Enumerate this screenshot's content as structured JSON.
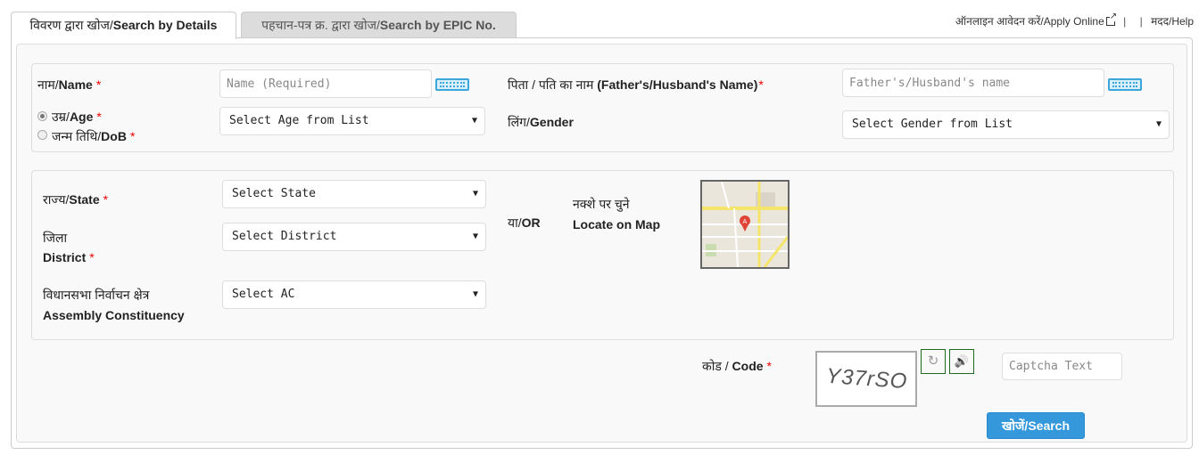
{
  "tabs": [
    {
      "hi": "विवरण द्वारा खोज/",
      "en": "Search by Details",
      "active": true
    },
    {
      "hi": "पहचान-पत्र क्र. द्वारा खोज/",
      "en": "Search by EPIC No.",
      "active": false
    }
  ],
  "top_links": {
    "apply_online": "ऑनलाइन आवेदन करें/Apply Online",
    "separator": "|",
    "help": "मदद/Help"
  },
  "form": {
    "name": {
      "hi": "नाम/",
      "en": "Name",
      "required": "*",
      "placeholder": "Name (Required)",
      "value": ""
    },
    "father_name": {
      "hi": "पिता / पति का नाम ",
      "en": "(Father's/Husband's Name)",
      "required": "*",
      "placeholder": "Father's/Husband's name",
      "value": ""
    },
    "age_option": {
      "hi": "उम्र/",
      "en": "Age",
      "required": "*",
      "checked": true
    },
    "dob_option": {
      "hi": "जन्म तिथि/",
      "en": "DoB",
      "required": "*",
      "checked": false
    },
    "age_select": {
      "selected": "Select Age from List"
    },
    "gender": {
      "hi": "लिंग/",
      "en": "Gender",
      "selected": "Select Gender from List"
    },
    "state": {
      "hi": "राज्य/",
      "en": "State",
      "required": "*",
      "selected": "Select State"
    },
    "district": {
      "hi": "जिला",
      "en": "District",
      "required": "*",
      "selected": "Select District"
    },
    "ac": {
      "hi": "विधानसभा निर्वाचन क्षेत्र",
      "en": "Assembly Constituency",
      "selected": "Select AC"
    },
    "or_label": {
      "hi": "या/",
      "en": "OR"
    },
    "map": {
      "hi": "नक्शे पर चुने",
      "en": "Locate on Map"
    },
    "code": {
      "hi": "कोड / ",
      "en": "Code",
      "required": "*"
    },
    "captcha": {
      "image_text": "Y37rSO",
      "placeholder": "Captcha Text",
      "value": ""
    },
    "search_button": "खोजें/Search"
  },
  "icons": {
    "caret": "▼",
    "refresh": "↻",
    "speaker": "🔊"
  },
  "colors": {
    "primary_button": "#3498db",
    "required": "#e00000",
    "keyboard_icon": "#3aa6dc",
    "icon_button_border": "#1d6b1d"
  }
}
